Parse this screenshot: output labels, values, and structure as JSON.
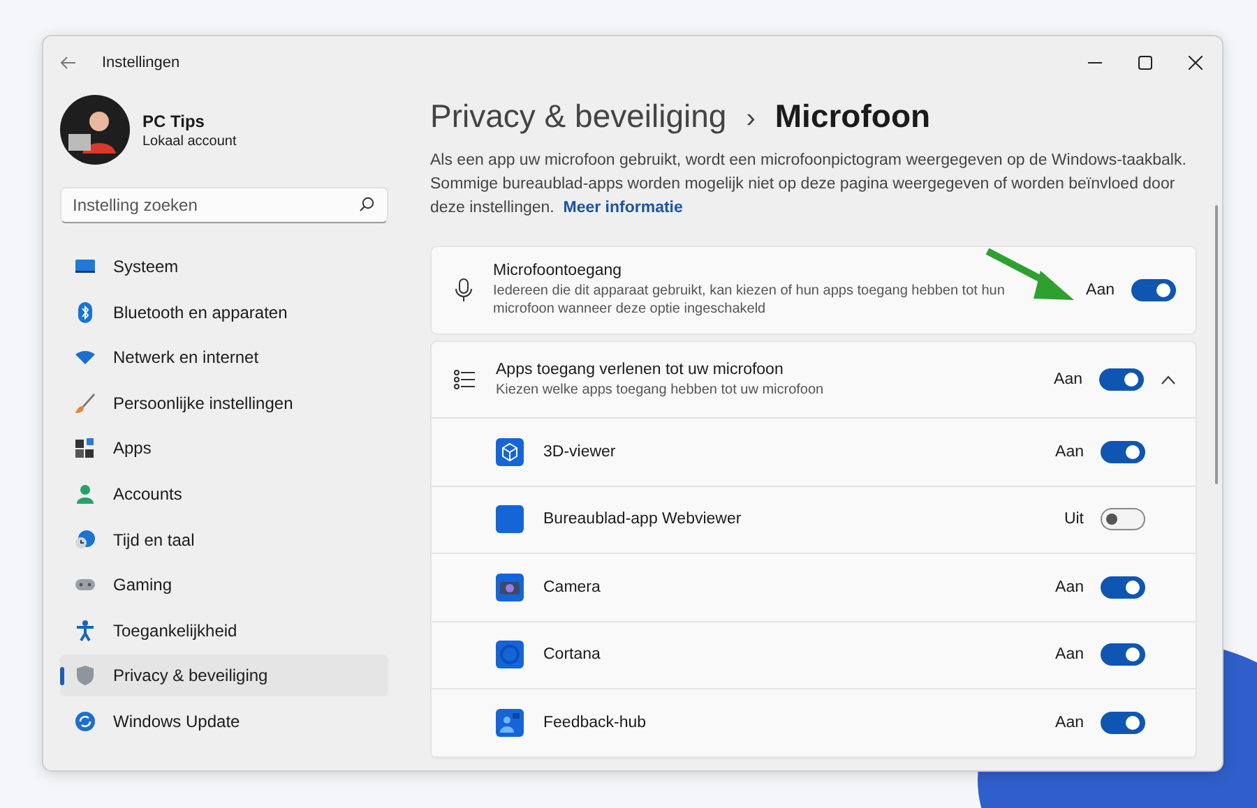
{
  "window": {
    "title": "Instellingen"
  },
  "account": {
    "name": "PC Tips",
    "type": "Lokaal account"
  },
  "search": {
    "placeholder": "Instelling zoeken"
  },
  "sidebar": {
    "items": [
      {
        "label": "Systeem",
        "kind": "system",
        "selected": false
      },
      {
        "label": "Bluetooth en apparaten",
        "kind": "bluetooth",
        "selected": false
      },
      {
        "label": "Netwerk en internet",
        "kind": "network",
        "selected": false
      },
      {
        "label": "Persoonlijke instellingen",
        "kind": "brush",
        "selected": false
      },
      {
        "label": "Apps",
        "kind": "apps",
        "selected": false
      },
      {
        "label": "Accounts",
        "kind": "person",
        "selected": false
      },
      {
        "label": "Tijd en taal",
        "kind": "clock",
        "selected": false
      },
      {
        "label": "Gaming",
        "kind": "gamepad",
        "selected": false
      },
      {
        "label": "Toegankelijkheid",
        "kind": "accessibility",
        "selected": false
      },
      {
        "label": "Privacy & beveiliging",
        "kind": "shield",
        "selected": true
      },
      {
        "label": "Windows Update",
        "kind": "update",
        "selected": false
      }
    ]
  },
  "breadcrumb": {
    "parent": "Privacy & beveiliging",
    "separator": "›",
    "current": "Microfoon"
  },
  "description": {
    "text": "Als een app uw microfoon gebruikt, wordt een microfoonpictogram weergegeven op de Windows-taakbalk. Sommige bureaublad-apps worden mogelijk niet op deze pagina weergegeven of worden beïnvloed door deze instellingen.",
    "link": "Meer informatie"
  },
  "microphone_access": {
    "title": "Microfoontoegang",
    "subtitle": "Iedereen die dit apparaat gebruikt, kan kiezen of hun apps toegang hebben tot hun microfoon wanneer deze optie ingeschakeld",
    "state_label": "Aan",
    "on": true
  },
  "app_access": {
    "title": "Apps toegang verlenen tot uw microfoon",
    "subtitle": "Kiezen welke apps toegang hebben tot uw microfoon",
    "state_label": "Aan",
    "on": true,
    "expanded": true,
    "apps": [
      {
        "name": "3D-viewer",
        "kind": "cube",
        "state_label": "Aan",
        "on": true
      },
      {
        "name": "Bureaublad-app Webviewer",
        "kind": "plain",
        "state_label": "Uit",
        "on": false
      },
      {
        "name": "Camera",
        "kind": "camera",
        "state_label": "Aan",
        "on": true
      },
      {
        "name": "Cortana",
        "kind": "ring",
        "state_label": "Aan",
        "on": true
      },
      {
        "name": "Feedback-hub",
        "kind": "feedback",
        "state_label": "Aan",
        "on": true
      }
    ]
  }
}
